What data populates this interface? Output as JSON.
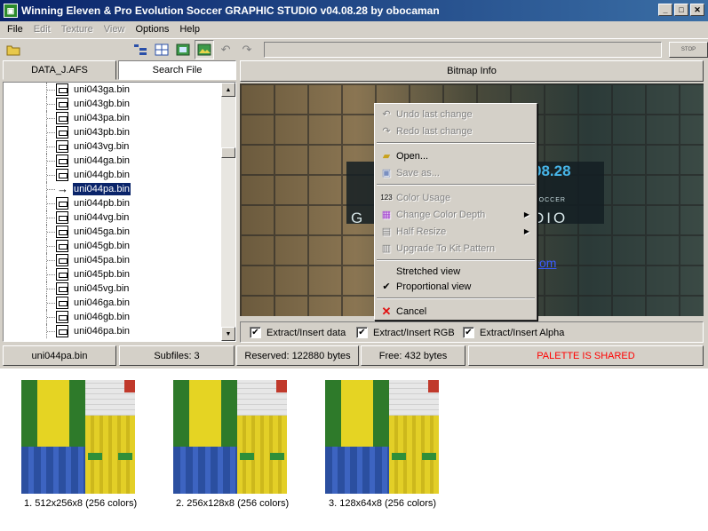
{
  "window": {
    "title": "Winning Eleven & Pro Evolution Soccer GRAPHIC STUDIO v04.08.28 by obocaman"
  },
  "menu": [
    "File",
    "Edit",
    "Texture",
    "View",
    "Options",
    "Help"
  ],
  "toolbar": {
    "stop_label": "STOP"
  },
  "left_tabs": {
    "afs_tab": "DATA_J.AFS",
    "search_tab": "Search File"
  },
  "right_header": {
    "bitmap_info": "Bitmap Info"
  },
  "tree": {
    "files": [
      "uni043ga.bin",
      "uni043gb.bin",
      "uni043pa.bin",
      "uni043pb.bin",
      "uni043vg.bin",
      "uni044ga.bin",
      "uni044gb.bin",
      "uni044pa.bin",
      "uni044pb.bin",
      "uni044vg.bin",
      "uni045ga.bin",
      "uni045gb.bin",
      "uni045pa.bin",
      "uni045pb.bin",
      "uni045vg.bin",
      "uni046ga.bin",
      "uni046gb.bin",
      "uni046pa.bin"
    ],
    "selected_index": 7
  },
  "preview": {
    "version_text": "08.28",
    "subtitle_text": "N SOCCER",
    "studio_text": "DIO",
    "g_text": "G",
    "url_text": "com"
  },
  "context_menu": {
    "undo": "Undo last change",
    "redo": "Redo last change",
    "open": "Open...",
    "save_as": "Save as...",
    "color_usage": "Color Usage",
    "change_color_depth": "Change Color Depth",
    "half_resize": "Half Resize",
    "upgrade_kit": "Upgrade To Kit Pattern",
    "stretched_view": "Stretched view",
    "proportional_view": "Proportional view",
    "cancel": "Cancel"
  },
  "checks": {
    "extract_data": "Extract/Insert data",
    "extract_rgb": "Extract/Insert RGB",
    "extract_alpha": "Extract/Insert Alpha"
  },
  "status": {
    "filename": "uni044pa.bin",
    "subfiles": "Subfiles: 3",
    "reserved": "Reserved: 122880 bytes",
    "free": "Free: 432 bytes",
    "palette": "PALETTE IS SHARED",
    "palette_color": "#ff0000"
  },
  "thumbnails": [
    {
      "label": "1. 512x256x8 (256 colors)"
    },
    {
      "label": "2. 256x128x8 (256 colors)"
    },
    {
      "label": "3. 128x64x8 (256 colors)"
    }
  ]
}
